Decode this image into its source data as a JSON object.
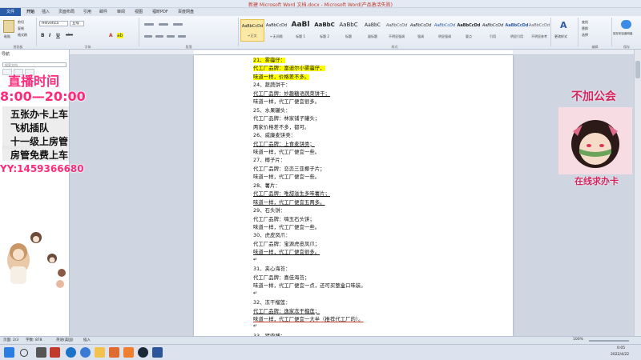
{
  "window": {
    "title": "新建 Microsoft Word 文档.docx - Microsoft Word(产品激活失败)"
  },
  "ribbon": {
    "tabs": [
      "文件",
      "开始",
      "插入",
      "页面布局",
      "引用",
      "邮件",
      "审阅",
      "视图",
      "福昕PDF",
      "百度网盘"
    ],
    "clipboard": {
      "paste": "粘贴",
      "cut": "剪切",
      "copy": "复制",
      "format_painter": "格式刷",
      "group": "剪贴板"
    },
    "font": {
      "name": "Helvetica",
      "size": "五号",
      "group": "字体"
    },
    "paragraph": {
      "group": "段落"
    },
    "styles": {
      "items": [
        {
          "preview": "AaBbCcDd",
          "name": "↵正文"
        },
        {
          "preview": "AaBbCcDd",
          "name": "↵无间隔"
        },
        {
          "preview": "AaBl",
          "name": "标题 1"
        },
        {
          "preview": "AaBbC",
          "name": "标题 2"
        },
        {
          "preview": "AaBbC",
          "name": "标题"
        },
        {
          "preview": "AaBbC",
          "name": "副标题"
        },
        {
          "preview": "AaBbCcDd",
          "name": "不明显强调"
        },
        {
          "preview": "AaBbCcDd",
          "name": "强调"
        },
        {
          "preview": "AaBbCcDd",
          "name": "明显强调"
        },
        {
          "preview": "AaBbCcDd",
          "name": "要点"
        },
        {
          "preview": "AaBbCcDd",
          "name": "引用"
        },
        {
          "preview": "AaBbCcDd",
          "name": "明显引用"
        },
        {
          "preview": "AaBbCcDd",
          "name": "不明显参考"
        }
      ],
      "change_styles": "更改样式",
      "group": "样式"
    },
    "editing": {
      "find": "查找",
      "replace": "替换",
      "select": "选择",
      "group": "编辑"
    },
    "baidu": {
      "label": "保存到百度网盘",
      "group": "保存"
    }
  },
  "nav_pane": {
    "title": "导航",
    "search_placeholder": "搜索文档",
    "body_text": "搜索文档中的文本..."
  },
  "document": {
    "lines": [
      {
        "text": "21、雾霾仔：",
        "style": "hl"
      },
      {
        "text": "代工厂品牌：富迪尔小雾霾仔，",
        "style": "hl"
      },
      {
        "text": "味道一样，价格差不多。",
        "style": "hl"
      },
      {
        "text": "24、蔬蔬饼干：",
        "style": ""
      },
      {
        "text": "代工厂品牌：妙趣糖语蔬菜饼干；",
        "style": "ul"
      },
      {
        "text": "味道一样，代工厂便宜很多。",
        "style": ""
      },
      {
        "text": "25、水果罐头：",
        "style": ""
      },
      {
        "text": "代工厂品牌：林家铺子罐头；",
        "style": ""
      },
      {
        "text": "两家价格差不多，都可。",
        "style": ""
      },
      {
        "text": "26、威廉麦饼类：",
        "style": ""
      },
      {
        "text": "代工厂品牌：上食麦饼类；",
        "style": "ul"
      },
      {
        "text": "味道一样，代工厂便宜一些。",
        "style": ""
      },
      {
        "text": "27、椰子片：",
        "style": ""
      },
      {
        "text": "代工厂品牌：恋恋三亚椰子片；",
        "style": ""
      },
      {
        "text": "味道一样，代工厂便宜一些。",
        "style": ""
      },
      {
        "text": "28、薯片：",
        "style": ""
      },
      {
        "text": "代工厂品牌：唯甜滋生多味薯片；",
        "style": "ul"
      },
      {
        "text": "味道一样，代工厂便宜五两多。",
        "style": "ul"
      },
      {
        "text": "29、石头饼：",
        "style": ""
      },
      {
        "text": "代工厂品牌：嗨玉石头饼；",
        "style": ""
      },
      {
        "text": "味道一样，代工厂便宜一些。",
        "style": ""
      },
      {
        "text": "30、虎皮凤爪：",
        "style": ""
      },
      {
        "text": "代工厂品牌：宝源虎皮凤爪；",
        "style": ""
      },
      {
        "text": "味道一样，代工厂便宜很多。",
        "style": "ul"
      },
      {
        "text": "↵",
        "style": ""
      },
      {
        "text": "31、夹心海苔：",
        "style": ""
      },
      {
        "text": "代工厂品牌：喜佳海苔；",
        "style": ""
      },
      {
        "text": "味道一样，代工厂便宜一点，还可买整盒口味装。",
        "style": ""
      },
      {
        "text": "↵",
        "style": ""
      },
      {
        "text": "32、冻干榴莲：",
        "style": ""
      },
      {
        "text": "代工厂品牌：逸家冻干榴莲；",
        "style": "ul"
      },
      {
        "text": "味道一样，代工厂便宜一大半（推荐代工厂的）。",
        "style": "partial"
      },
      {
        "text": "↵",
        "style": ""
      },
      {
        "text": "33、猪肉脯：",
        "style": ""
      }
    ]
  },
  "status_bar": {
    "page": "页面: 2/3",
    "words": "字数: 878",
    "lang": "英语(美国)",
    "mode": "插入",
    "zoom": "100%"
  },
  "taskbar": {
    "time": "0:05",
    "date": "2022/4/22"
  },
  "overlay": {
    "left_title": "直播时间",
    "left_time": "8:00—20:00",
    "info_lines": [
      "五张办卡上车",
      "飞机插队",
      "十一级上房管",
      "房管免费上车"
    ],
    "yy": "YY:1459366680",
    "right_title": "不加公会",
    "right_sub": "在线求办卡"
  },
  "colors": {
    "file_tab": "#2a5ba8",
    "highlight": "#ffff00",
    "overlay_pink": "#ff2b7a",
    "right_pink": "#d6255e"
  }
}
